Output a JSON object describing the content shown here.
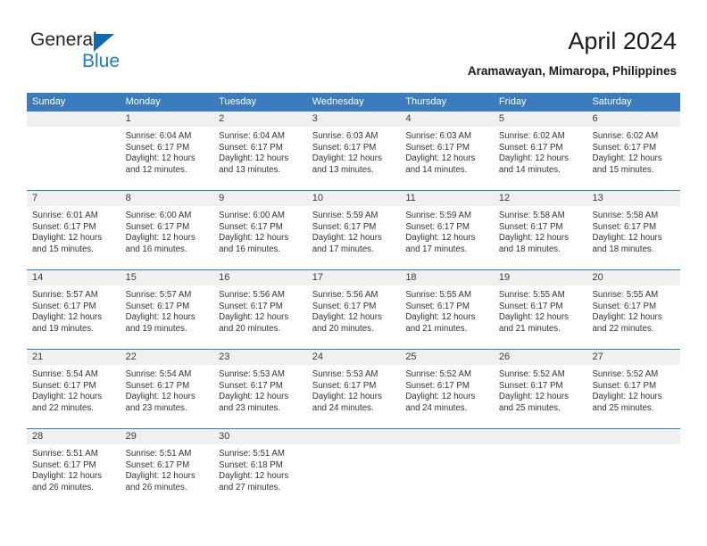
{
  "brand": {
    "name_part1": "General",
    "name_part2": "Blue",
    "triangle_color": "#1269b0",
    "blue_color": "#1f7ac4"
  },
  "header": {
    "title": "April 2024",
    "subtitle": "Aramawayan, Mimaropa, Philippines"
  },
  "theme": {
    "header_blue": "#3a7cbe",
    "day_band_gray": "#f0f0f0",
    "text_color": "#333333"
  },
  "weekdays": [
    "Sunday",
    "Monday",
    "Tuesday",
    "Wednesday",
    "Thursday",
    "Friday",
    "Saturday"
  ],
  "weeks": [
    [
      {
        "day": "",
        "blank": true,
        "lines": [
          "",
          "",
          "",
          ""
        ]
      },
      {
        "day": "1",
        "lines": [
          "Sunrise: 6:04 AM",
          "Sunset: 6:17 PM",
          "Daylight: 12 hours",
          "and 12 minutes."
        ]
      },
      {
        "day": "2",
        "lines": [
          "Sunrise: 6:04 AM",
          "Sunset: 6:17 PM",
          "Daylight: 12 hours",
          "and 13 minutes."
        ]
      },
      {
        "day": "3",
        "lines": [
          "Sunrise: 6:03 AM",
          "Sunset: 6:17 PM",
          "Daylight: 12 hours",
          "and 13 minutes."
        ]
      },
      {
        "day": "4",
        "lines": [
          "Sunrise: 6:03 AM",
          "Sunset: 6:17 PM",
          "Daylight: 12 hours",
          "and 14 minutes."
        ]
      },
      {
        "day": "5",
        "lines": [
          "Sunrise: 6:02 AM",
          "Sunset: 6:17 PM",
          "Daylight: 12 hours",
          "and 14 minutes."
        ]
      },
      {
        "day": "6",
        "lines": [
          "Sunrise: 6:02 AM",
          "Sunset: 6:17 PM",
          "Daylight: 12 hours",
          "and 15 minutes."
        ]
      }
    ],
    [
      {
        "day": "7",
        "lines": [
          "Sunrise: 6:01 AM",
          "Sunset: 6:17 PM",
          "Daylight: 12 hours",
          "and 15 minutes."
        ]
      },
      {
        "day": "8",
        "lines": [
          "Sunrise: 6:00 AM",
          "Sunset: 6:17 PM",
          "Daylight: 12 hours",
          "and 16 minutes."
        ]
      },
      {
        "day": "9",
        "lines": [
          "Sunrise: 6:00 AM",
          "Sunset: 6:17 PM",
          "Daylight: 12 hours",
          "and 16 minutes."
        ]
      },
      {
        "day": "10",
        "lines": [
          "Sunrise: 5:59 AM",
          "Sunset: 6:17 PM",
          "Daylight: 12 hours",
          "and 17 minutes."
        ]
      },
      {
        "day": "11",
        "lines": [
          "Sunrise: 5:59 AM",
          "Sunset: 6:17 PM",
          "Daylight: 12 hours",
          "and 17 minutes."
        ]
      },
      {
        "day": "12",
        "lines": [
          "Sunrise: 5:58 AM",
          "Sunset: 6:17 PM",
          "Daylight: 12 hours",
          "and 18 minutes."
        ]
      },
      {
        "day": "13",
        "lines": [
          "Sunrise: 5:58 AM",
          "Sunset: 6:17 PM",
          "Daylight: 12 hours",
          "and 18 minutes."
        ]
      }
    ],
    [
      {
        "day": "14",
        "lines": [
          "Sunrise: 5:57 AM",
          "Sunset: 6:17 PM",
          "Daylight: 12 hours",
          "and 19 minutes."
        ]
      },
      {
        "day": "15",
        "lines": [
          "Sunrise: 5:57 AM",
          "Sunset: 6:17 PM",
          "Daylight: 12 hours",
          "and 19 minutes."
        ]
      },
      {
        "day": "16",
        "lines": [
          "Sunrise: 5:56 AM",
          "Sunset: 6:17 PM",
          "Daylight: 12 hours",
          "and 20 minutes."
        ]
      },
      {
        "day": "17",
        "lines": [
          "Sunrise: 5:56 AM",
          "Sunset: 6:17 PM",
          "Daylight: 12 hours",
          "and 20 minutes."
        ]
      },
      {
        "day": "18",
        "lines": [
          "Sunrise: 5:55 AM",
          "Sunset: 6:17 PM",
          "Daylight: 12 hours",
          "and 21 minutes."
        ]
      },
      {
        "day": "19",
        "lines": [
          "Sunrise: 5:55 AM",
          "Sunset: 6:17 PM",
          "Daylight: 12 hours",
          "and 21 minutes."
        ]
      },
      {
        "day": "20",
        "lines": [
          "Sunrise: 5:55 AM",
          "Sunset: 6:17 PM",
          "Daylight: 12 hours",
          "and 22 minutes."
        ]
      }
    ],
    [
      {
        "day": "21",
        "lines": [
          "Sunrise: 5:54 AM",
          "Sunset: 6:17 PM",
          "Daylight: 12 hours",
          "and 22 minutes."
        ]
      },
      {
        "day": "22",
        "lines": [
          "Sunrise: 5:54 AM",
          "Sunset: 6:17 PM",
          "Daylight: 12 hours",
          "and 23 minutes."
        ]
      },
      {
        "day": "23",
        "lines": [
          "Sunrise: 5:53 AM",
          "Sunset: 6:17 PM",
          "Daylight: 12 hours",
          "and 23 minutes."
        ]
      },
      {
        "day": "24",
        "lines": [
          "Sunrise: 5:53 AM",
          "Sunset: 6:17 PM",
          "Daylight: 12 hours",
          "and 24 minutes."
        ]
      },
      {
        "day": "25",
        "lines": [
          "Sunrise: 5:52 AM",
          "Sunset: 6:17 PM",
          "Daylight: 12 hours",
          "and 24 minutes."
        ]
      },
      {
        "day": "26",
        "lines": [
          "Sunrise: 5:52 AM",
          "Sunset: 6:17 PM",
          "Daylight: 12 hours",
          "and 25 minutes."
        ]
      },
      {
        "day": "27",
        "lines": [
          "Sunrise: 5:52 AM",
          "Sunset: 6:17 PM",
          "Daylight: 12 hours",
          "and 25 minutes."
        ]
      }
    ],
    [
      {
        "day": "28",
        "lines": [
          "Sunrise: 5:51 AM",
          "Sunset: 6:17 PM",
          "Daylight: 12 hours",
          "and 26 minutes."
        ]
      },
      {
        "day": "29",
        "lines": [
          "Sunrise: 5:51 AM",
          "Sunset: 6:17 PM",
          "Daylight: 12 hours",
          "and 26 minutes."
        ]
      },
      {
        "day": "30",
        "lines": [
          "Sunrise: 5:51 AM",
          "Sunset: 6:18 PM",
          "Daylight: 12 hours",
          "and 27 minutes."
        ]
      },
      {
        "day": "",
        "blank": true,
        "lines": [
          "",
          "",
          "",
          ""
        ]
      },
      {
        "day": "",
        "blank": true,
        "lines": [
          "",
          "",
          "",
          ""
        ]
      },
      {
        "day": "",
        "blank": true,
        "lines": [
          "",
          "",
          "",
          ""
        ]
      },
      {
        "day": "",
        "blank": true,
        "lines": [
          "",
          "",
          "",
          ""
        ]
      }
    ]
  ]
}
